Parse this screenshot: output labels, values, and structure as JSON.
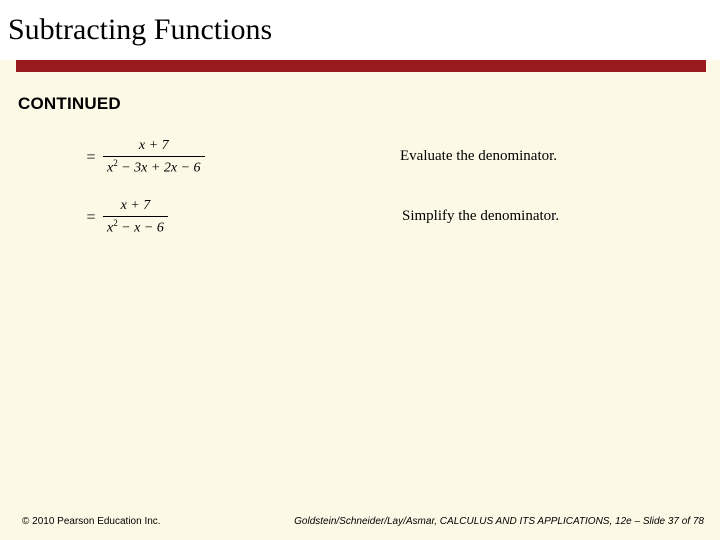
{
  "title": "Subtracting Functions",
  "continued_label": "CONTINUED",
  "rows": [
    {
      "equals": "=",
      "numerator_html": "x + 7",
      "denominator_html": "x² − 3x + 2x − 6",
      "explanation": "Evaluate the denominator."
    },
    {
      "equals": "=",
      "numerator_html": "x + 7",
      "denominator_html": "x² − x − 6",
      "explanation": "Simplify the denominator."
    }
  ],
  "footer": {
    "copyright": "© 2010 Pearson Education Inc.",
    "attribution_prefix": "Goldstein/Schneider/Lay/Asmar, ",
    "book_title": "CALCULUS AND ITS APPLICATIONS",
    "edition_slide": ", 12e – Slide 37 of 78"
  }
}
